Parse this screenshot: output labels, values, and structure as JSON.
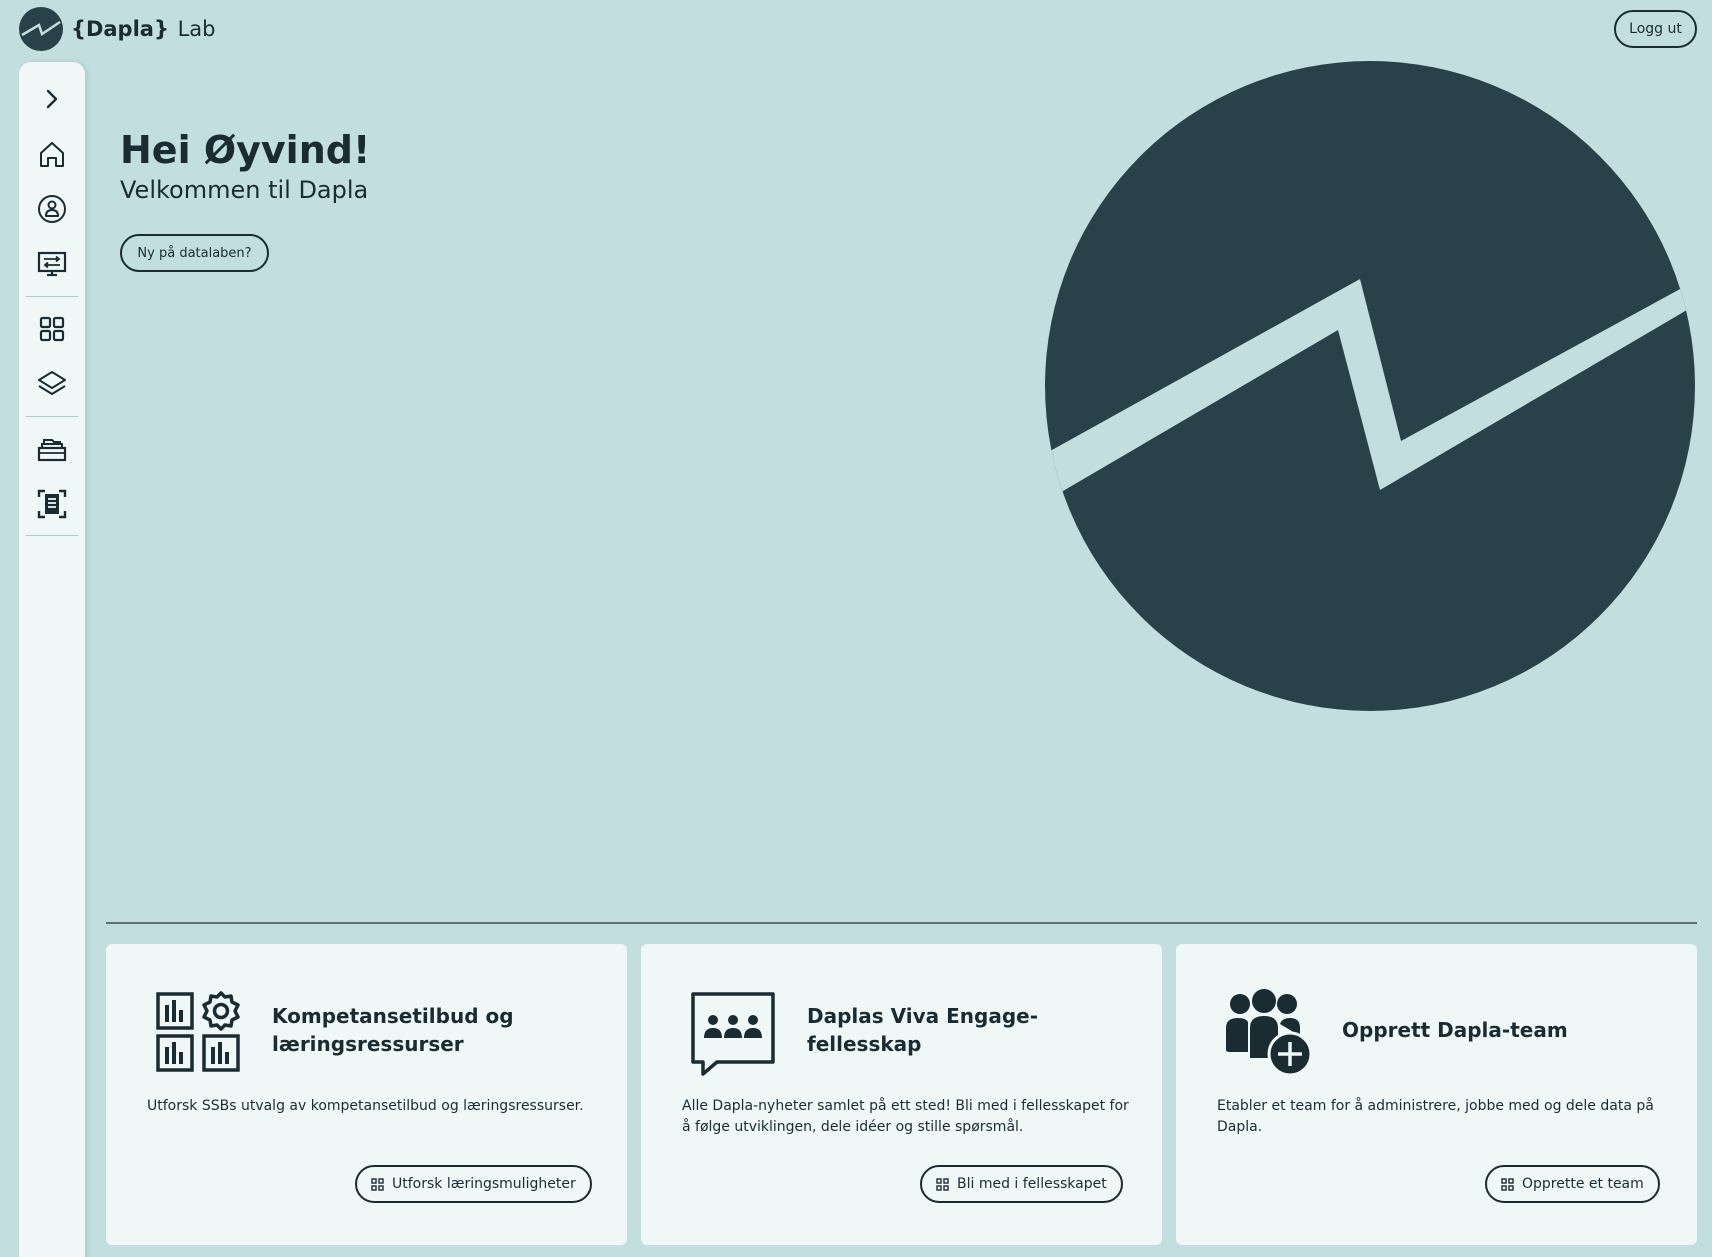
{
  "header": {
    "brand_name": "{Dapla}",
    "brand_suffix": "Lab",
    "logout_label": "Logg ut"
  },
  "sidebar": {
    "items": [
      {
        "name": "expand",
        "icon": "chevron-right-icon"
      },
      {
        "name": "home",
        "icon": "home-icon"
      },
      {
        "name": "user",
        "icon": "user-circle-icon"
      },
      {
        "name": "services",
        "icon": "monitor-transfer-icon"
      },
      {
        "name": "apps",
        "icon": "grid-icon"
      },
      {
        "name": "layers",
        "icon": "layers-icon"
      },
      {
        "name": "storage",
        "icon": "folder-stack-icon"
      },
      {
        "name": "catalog",
        "icon": "document-scan-icon"
      }
    ]
  },
  "hero": {
    "title": "Hei Øyvind!",
    "subtitle": "Velkommen til Dapla",
    "new_button": "Ny på datalaben?"
  },
  "cards": [
    {
      "title": "Kompetansetilbud og læringsressurser",
      "description": "Utforsk SSBs utvalg av kompetansetilbud og læringsressurser.",
      "button": "Utforsk læringsmuligheter",
      "icon": "charts-gear-icon"
    },
    {
      "title": "Daplas Viva Engage-fellesskap",
      "description": "Alle Dapla-nyheter samlet på ett sted! Bli med i fellesskapet for å følge utviklingen, dele idéer og stille spørsmål.",
      "button": "Bli med i fellesskapet",
      "icon": "chat-people-icon"
    },
    {
      "title": "Opprett Dapla-team",
      "description": "Etabler et team for å administrere, jobbe med og dele data på Dapla.",
      "button": "Opprette et team",
      "icon": "team-add-icon"
    }
  ],
  "colors": {
    "background": "#c3dede",
    "dark": "#29424a",
    "panel": "#eff7f7",
    "text": "#1a2c32"
  }
}
